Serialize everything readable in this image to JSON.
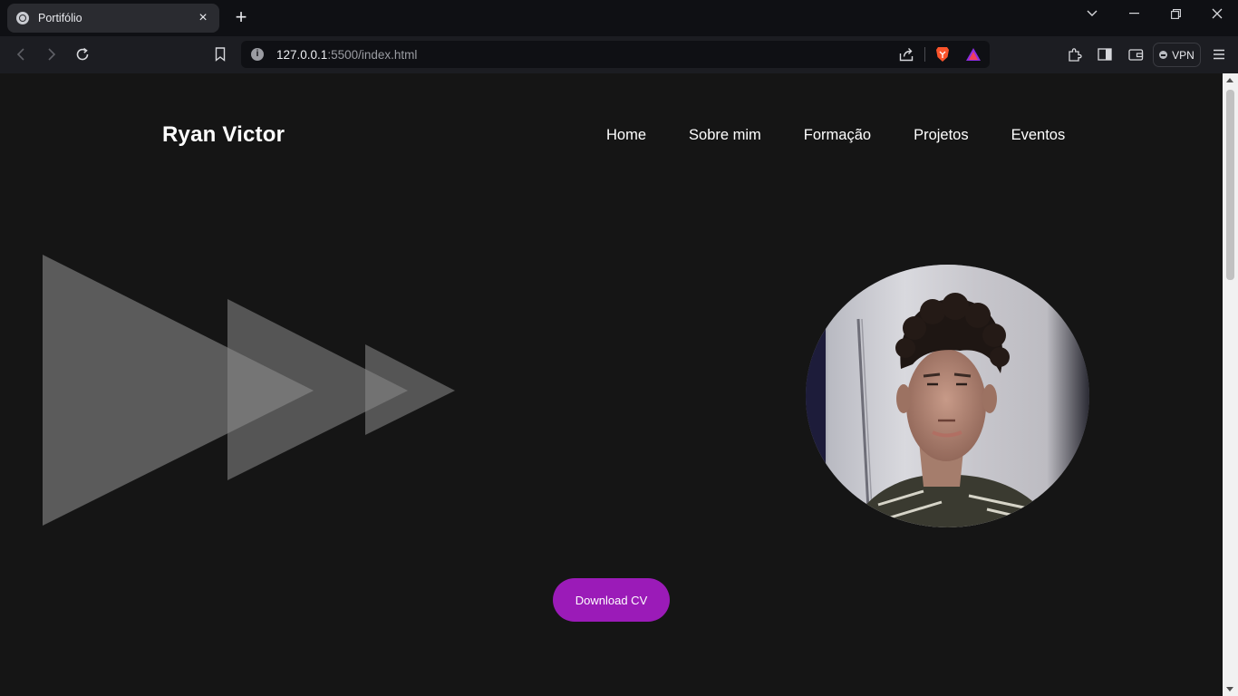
{
  "browser": {
    "tab_title": "Portifólio",
    "url_host": "127.0.0.1",
    "url_path": ":5500/index.html",
    "vpn_label": "VPN"
  },
  "page": {
    "brand": "Ryan Victor",
    "nav": [
      "Home",
      "Sobre mim",
      "Formação",
      "Projetos",
      "Eventos"
    ],
    "cv_button": "Download CV"
  },
  "colors": {
    "page_bg": "#151515",
    "accent": "#9b1bb8",
    "triangle": "#777777"
  }
}
